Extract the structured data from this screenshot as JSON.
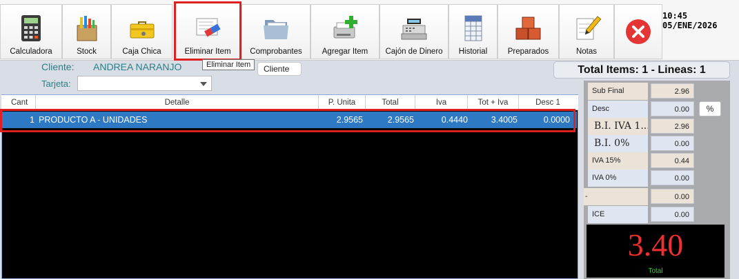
{
  "toolbar": {
    "buttons": [
      {
        "label": "Calculadora",
        "icon": "calculator-icon"
      },
      {
        "label": "Stock",
        "icon": "stock-box-icon"
      },
      {
        "label": "Caja Chica",
        "icon": "toolbox-icon"
      },
      {
        "label": "Eliminar Item",
        "icon": "eraser-icon"
      },
      {
        "label": "Comprobantes",
        "icon": "folder-icon"
      },
      {
        "label": "Agregar Item",
        "icon": "add-printer-icon"
      },
      {
        "label": "Cajón de Dinero",
        "icon": "cash-register-icon"
      },
      {
        "label": "Historial",
        "icon": "history-grid-icon"
      },
      {
        "label": "Preparados",
        "icon": "boxes-icon"
      },
      {
        "label": "Notas",
        "icon": "pencil-note-icon"
      }
    ],
    "close_icon": "close-icon"
  },
  "clock": {
    "time": "10:45",
    "date": "05/ENE/2026"
  },
  "tooltip": "Eliminar Item",
  "client": {
    "label": "Cliente:",
    "value": "ANDREA NARANJO",
    "button": "Cliente",
    "card_label": "Tarjeta:",
    "card_value": ""
  },
  "summary": "Total Items: 1 - Lineas: 1",
  "grid": {
    "columns": [
      "Cant",
      "Detalle",
      "P. Unita",
      "Total",
      "Iva",
      "Tot + Iva",
      "Desc 1"
    ],
    "rows": [
      {
        "cant": "1",
        "detalle": "PRODUCTO A  - UNIDADES",
        "p_unita": "2.9565",
        "total": "2.9565",
        "iva": "0.4440",
        "tot_iva": "3.4005",
        "desc1": "0.0000"
      }
    ]
  },
  "totals": [
    {
      "label": "Sub Final",
      "value": "2.96"
    },
    {
      "label": "Desc",
      "value": "0.00"
    },
    {
      "label": "B.I. IVA 1...",
      "value": "2.96"
    },
    {
      "label": "B.I. 0%",
      "value": "0.00"
    },
    {
      "label": "IVA 15%",
      "value": "0.44"
    },
    {
      "label": "IVA 0%",
      "value": "0.00"
    },
    {
      "label": "-",
      "value": "0.00"
    },
    {
      "label": "ICE",
      "value": "0.00"
    }
  ],
  "percent_button": "%",
  "grand_total": {
    "value": "3.40",
    "caption": "Total"
  },
  "colors": {
    "accent_red": "#e02020",
    "selection_blue": "#2d79c4",
    "total_red": "#ef3030",
    "total_green": "#39c93b"
  }
}
